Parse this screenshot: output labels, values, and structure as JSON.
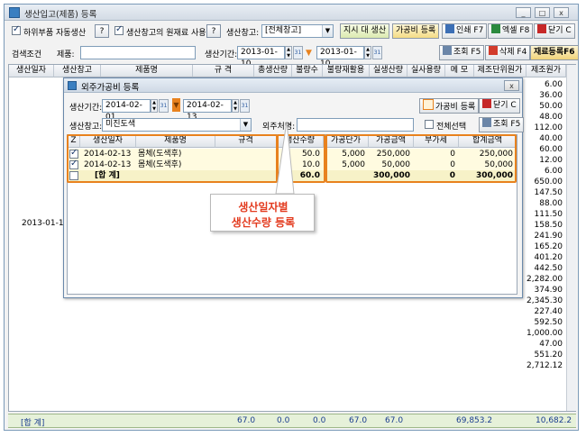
{
  "window": {
    "title": "생산입고(제품) 등록",
    "buttons": {
      "min": "_",
      "max": "□",
      "close": "x"
    }
  },
  "toolbar": {
    "auto_sub_label": "하위부품 자동생산",
    "use_raw_label": "생산창고의 원재료 사용",
    "help": "?",
    "warehouse_label": "생산창고:",
    "warehouse_value": "[전체창고]",
    "btn_order_prod": "지시 대 생산",
    "btn_processing": "가공비 등록",
    "btn_print": "인쇄 F7",
    "btn_excel": "엑셀 F8",
    "btn_close": "닫기 C"
  },
  "search": {
    "cond_label": "검색조건",
    "product_label": "제품:",
    "product_value": "",
    "period_label": "생산기간:",
    "from": "2013-01-10",
    "to": "2013-01-10",
    "btn_query": "조회 F5",
    "btn_delete": "삭제 F4",
    "btn_material": "재료등록F6"
  },
  "main_table": {
    "headers": [
      "생산일자",
      "생산창고",
      "제품명",
      "규 격",
      "총생산량",
      "불량수",
      "불량재활용",
      "실생산량",
      "실사용량",
      "메 모",
      "제조단위원가",
      "제조원가"
    ],
    "date_cell": "2013-01-10",
    "cost_values": [
      "6.00",
      "36.00",
      "50.00",
      "48.00",
      "112.00",
      "40.00",
      "60.00",
      "12.00",
      "6.00",
      "650.00",
      "147.50",
      "88.00",
      "111.50",
      "158.50",
      "241.90",
      "165.20",
      "401.20",
      "442.50",
      "2,282.00",
      "374.90",
      "2,345.30",
      "227.40",
      "592.50",
      "1,000.00",
      "47.00",
      "551.20",
      "2,712.12"
    ]
  },
  "totals": {
    "label": "[합 계]",
    "total_prod": "67.0",
    "defect": "0.0",
    "defect_recycle": "0.0",
    "real_prod": "67.0",
    "real_used": "67.0",
    "unit_cost_sum": "69,853.2",
    "cost_sum": "10,682.2"
  },
  "dialog": {
    "title": "외주가공비 등록",
    "close": "x",
    "period_label": "생산기간:",
    "from": "2014-02-01",
    "to": "2014-02-13",
    "btn_register": "가공비 등록",
    "btn_close": "닫기 C",
    "warehouse_label": "생산창고:",
    "warehouse_value": "미진도색",
    "vendor_label": "외주처명:",
    "vendor_value": "",
    "select_all_label": "전체선택",
    "btn_query": "조회 F5",
    "headers": [
      "Z",
      "생산일자",
      "제품명",
      "규격",
      "생산수량",
      "가공단가",
      "가공금액",
      "부가세",
      "합계금액"
    ],
    "rows": [
      {
        "checked": true,
        "date": "2014-02-13",
        "product": "몸체(도색후)",
        "spec": "",
        "qty": "50.0",
        "unit_price": "5,000",
        "amount": "250,000",
        "vat": "0",
        "total": "250,000"
      },
      {
        "checked": true,
        "date": "2014-02-13",
        "product": "몸체(도색후)",
        "spec": "",
        "qty": "10.0",
        "unit_price": "5,000",
        "amount": "50,000",
        "vat": "0",
        "total": "50,000"
      }
    ],
    "sum_row": {
      "label": "[합 계]",
      "qty": "60.0",
      "amount": "300,000",
      "vat": "0",
      "total": "300,000"
    }
  },
  "callout": {
    "line1": "생산일자별",
    "line2": "생산수량 등록"
  },
  "colors": {
    "highlight": "#e8821e",
    "callout_text": "#e33b1f",
    "total_bar": "#e6f1d9"
  }
}
